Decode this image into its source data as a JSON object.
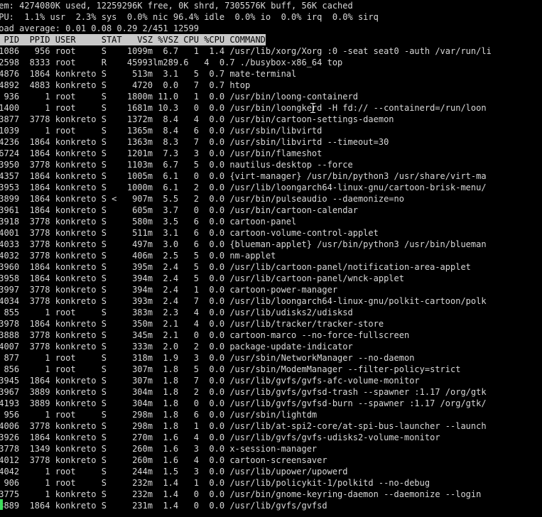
{
  "summary": {
    "mem": "Mem: 4274080K used, 12259296K free, 0K shrd, 7305576K buff, 56K cached",
    "cpu": "CPU:  1.1% usr  2.3% sys  0.0% nic 96.4% idle  0.0% io  0.0% irq  0.0% sirq",
    "load": "Load average: 0.01 0.08 0.29 2/451 12599"
  },
  "header": "  PID  PPID USER     STAT   VSZ %VSZ CPU %CPU COMMAND",
  "rows": [
    " 1086   956 root     S    1099m  6.7   1  1.4 /usr/lib/xorg/Xorg :0 -seat seat0 -auth /var/run/li",
    "12598  8333 root     R    45993lm289.6   4  0.7 ./busybox-x86_64 top",
    " 4876  1864 konkreto S     513m  3.1   5  0.7 mate-terminal",
    " 4892  4883 konkreto S     4720  0.0   7  0.7 htop",
    "  936     1 root     S    1800m 11.0   1  0.0 /usr/bin/loong-containerd",
    " 1400     1 root     S    1681m 10.3   0  0.0 /usr/bin/loongkerd -H fd:// --containerd=/run/loon",
    " 3877  3778 konkreto S    1372m  8.4   4  0.0 /usr/bin/cartoon-settings-daemon",
    " 1039     1 root     S    1365m  8.4   6  0.0 /usr/sbin/libvirtd",
    " 4236  1864 konkreto S    1363m  8.3   7  0.0 /usr/sbin/libvirtd --timeout=30",
    " 6724  1864 konkreto S    1201m  7.3   3  0.0 /usr/bin/flameshot",
    " 3950  3778 konkreto S    1103m  6.7   5  0.0 nautilus-desktop --force",
    " 4357  1864 konkreto S    1005m  6.1   0  0.0 {virt-manager} /usr/bin/python3 /usr/share/virt-ma",
    " 3953  1864 konkreto S    1000m  6.1   2  0.0 /usr/lib/loongarch64-linux-gnu/cartoon-brisk-menu/",
    " 3899  1864 konkreto S <   907m  5.5   2  0.0 /usr/bin/pulseaudio --daemonize=no",
    " 3961  1864 konkreto S     605m  3.7   0  0.0 /usr/bin/cartoon-calendar",
    " 3918  3778 konkreto S     580m  3.5   6  0.0 cartoon-panel",
    " 4001  3778 konkreto S     511m  3.1   6  0.0 cartoon-volume-control-applet",
    " 4033  3778 konkreto S     497m  3.0   6  0.0 {blueman-applet} /usr/bin/python3 /usr/bin/blueman",
    " 4032  3778 konkreto S     406m  2.5   5  0.0 nm-applet",
    " 3960  1864 konkreto S     395m  2.4   5  0.0 /usr/lib/cartoon-panel/notification-area-applet",
    " 3958  1864 konkreto S     394m  2.4   5  0.0 /usr/lib/cartoon-panel/wnck-applet",
    " 3997  3778 konkreto S     394m  2.4   1  0.0 cartoon-power-manager",
    " 4034  3778 konkreto S     393m  2.4   7  0.0 /usr/lib/loongarch64-linux-gnu/polkit-cartoon/polk",
    "  855     1 root     S     383m  2.3   4  0.0 /usr/lib/udisks2/udisksd",
    " 3978  1864 konkreto S     350m  2.1   4  0.0 /usr/lib/tracker/tracker-store",
    " 3888  3778 konkreto S     345m  2.1   0  0.0 cartoon-marco --no-force-fullscreen",
    " 4007  3778 konkreto S     333m  2.0   2  0.0 package-update-indicator",
    "  877     1 root     S     318m  1.9   3  0.0 /usr/sbin/NetworkManager --no-daemon",
    "  856     1 root     S     307m  1.8   5  0.0 /usr/sbin/ModemManager --filter-policy=strict",
    " 3945  1864 konkreto S     307m  1.8   7  0.0 /usr/lib/gvfs/gvfs-afc-volume-monitor",
    " 3967  3889 konkreto S     304m  1.8   2  0.0 /usr/lib/gvfs/gvfsd-trash --spawner :1.17 /org/gtk",
    " 4193  3889 konkreto S     304m  1.8   0  0.0 /usr/lib/gvfs/gvfsd-burn --spawner :1.17 /org/gtk/",
    "  956     1 root     S     298m  1.8   6  0.0 /usr/sbin/lightdm",
    " 4006  3778 konkreto S     298m  1.8   1  0.0 /usr/lib/at-spi2-core/at-spi-bus-launcher --launch",
    " 3926  1864 konkreto S     270m  1.6   4  0.0 /usr/lib/gvfs/gvfs-udisks2-volume-monitor",
    " 3778  1349 konkreto S     260m  1.6   3  0.0 x-session-manager",
    " 4012  3778 konkreto S     260m  1.6   4  0.0 cartoon-screensaver",
    " 4042     1 root     S     244m  1.5   3  0.0 /usr/lib/upower/upowerd",
    "  906     1 root     S     232m  1.4   1  0.0 /usr/lib/policykit-1/polkitd --no-debug",
    " 3775     1 konkreto S     232m  1.4   0  0.0 /usr/bin/gnome-keyring-daemon --daemonize --login",
    " 3889  1864 konkreto S     231m  1.4   0  0.0 /usr/lib/gvfs/gvfsd"
  ],
  "colors": {
    "background": "#000000",
    "text": "#d8d8d8",
    "header_bg": "#c8c8c8",
    "header_text": "#000000",
    "cursor": "#3ddc5a"
  },
  "icons": {
    "pointer": "text-cursor-icon"
  }
}
